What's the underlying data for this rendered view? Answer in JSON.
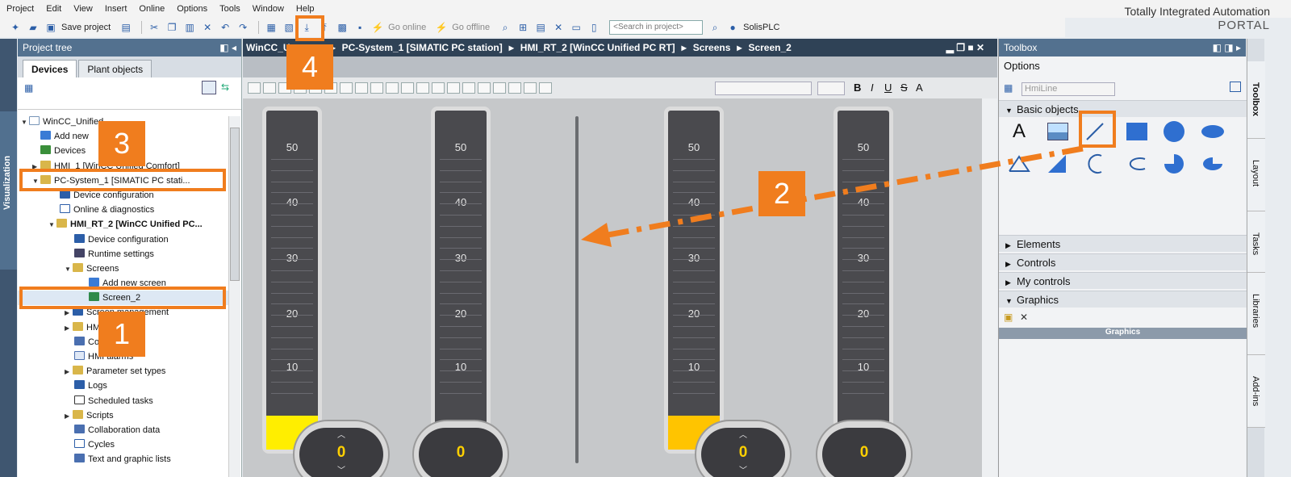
{
  "menu": [
    "Project",
    "Edit",
    "View",
    "Insert",
    "Online",
    "Options",
    "Tools",
    "Window",
    "Help"
  ],
  "brand": {
    "line1": "Totally Integrated Automation",
    "line2": "PORTAL"
  },
  "toolbar": {
    "save_label": "Save project",
    "go_online": "Go online",
    "go_offline": "Go offline",
    "search_placeholder": "<Search in project>",
    "plc_label": "SolisPLC"
  },
  "project_tree": {
    "title": "Project tree",
    "tabs": [
      "Devices",
      "Plant objects"
    ],
    "side_label": "Visualization",
    "items": [
      "WinCC_Unified",
      "Add new",
      "Devices",
      "HMI_1 [WinCC Unified Comfort]",
      "PC-System_1 [SIMATIC PC stati...",
      "Device configuration",
      "Online & diagnostics",
      "HMI_RT_2 [WinCC Unified PC...",
      "Device configuration",
      "Runtime settings",
      "Screens",
      "Add new screen",
      "Screen_2",
      "Screen management",
      "HMI tags",
      "Connections",
      "HMI alarms",
      "Parameter set types",
      "Logs",
      "Scheduled tasks",
      "Scripts",
      "Collaboration data",
      "Cycles",
      "Text and graphic lists"
    ]
  },
  "editor": {
    "breadcrumb": [
      "WinCC_U",
      "PC-System_1 [SIMATIC PC station]",
      "HMI_RT_2 [WinCC Unified PC RT]",
      "Screens",
      "Screen_2"
    ],
    "text_tools": {
      "bold": "B",
      "italic": "I",
      "underline": "U",
      "strike": "S",
      "grow": "A"
    },
    "gauge_labels": [
      "50",
      "40",
      "30",
      "20",
      "10"
    ],
    "gauges": [
      {
        "knob_value": "0",
        "has_spinner": true,
        "fill_level": 0.1
      },
      {
        "knob_value": "0",
        "has_spinner": false,
        "fill_level": 0
      },
      {
        "knob_value": "0",
        "has_spinner": true,
        "fill_level": 0.1
      },
      {
        "knob_value": "0",
        "has_spinner": false,
        "fill_level": 0
      }
    ]
  },
  "toolbox": {
    "title": "Toolbox",
    "options": "Options",
    "selected_tool": "HmiLine",
    "sections": {
      "basic": "Basic objects",
      "elements": "Elements",
      "controls": "Controls",
      "my_controls": "My controls",
      "graphics": "Graphics"
    },
    "graphics_bar": "Graphics",
    "text_tool": "A"
  },
  "right_tabs": [
    "Toolbox",
    "Layout",
    "Tasks",
    "Libraries",
    "Add-ins"
  ],
  "callouts": [
    "1",
    "2",
    "3",
    "4"
  ],
  "colors": {
    "accent": "#f07d1e",
    "header": "#53718f",
    "breadcrumb": "#2f4256",
    "value": "#ffd000"
  }
}
